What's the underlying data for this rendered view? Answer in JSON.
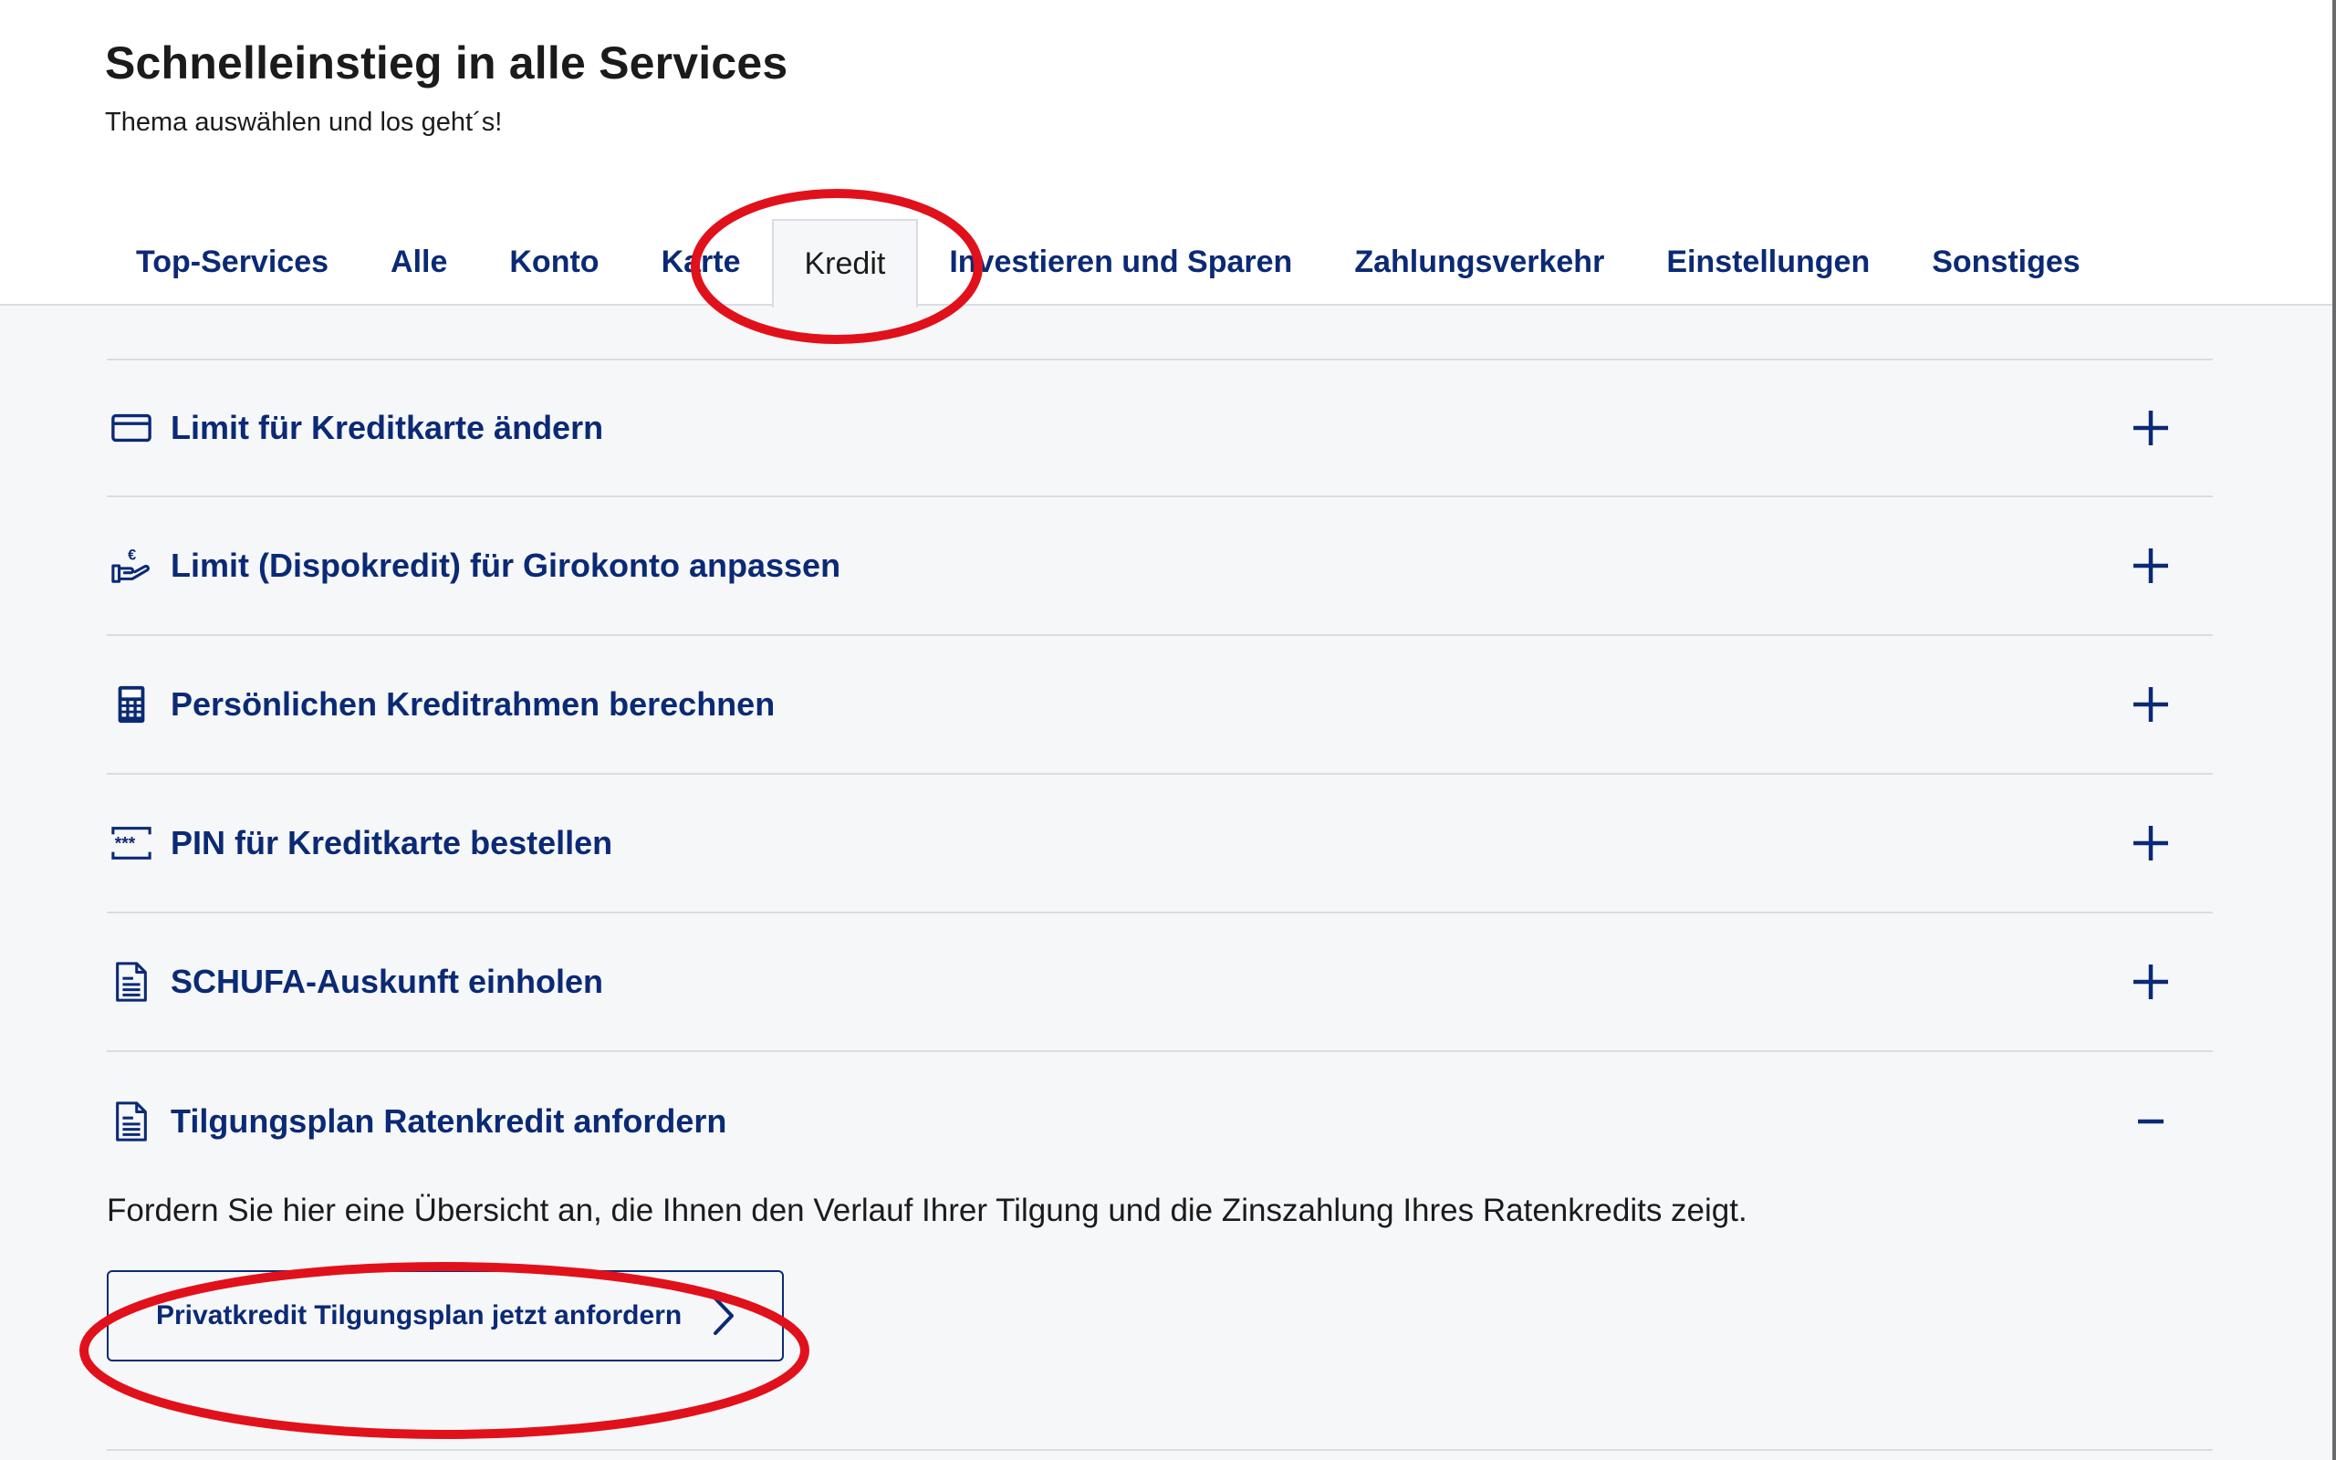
{
  "header": {
    "title": "Schnelleinstieg in alle Services",
    "subtitle": "Thema auswählen und los geht´s!"
  },
  "tabs": [
    {
      "label": "Top-Services",
      "active": false
    },
    {
      "label": "Alle",
      "active": false
    },
    {
      "label": "Konto",
      "active": false
    },
    {
      "label": "Karte",
      "active": false
    },
    {
      "label": "Kredit",
      "active": true
    },
    {
      "label": "Investieren und Sparen",
      "active": false
    },
    {
      "label": "Zahlungsverkehr",
      "active": false
    },
    {
      "label": "Einstellungen",
      "active": false
    },
    {
      "label": "Sonstiges",
      "active": false
    }
  ],
  "services": [
    {
      "label": "Limit für Kreditkarte ändern",
      "icon": "credit-card-icon",
      "expanded": false
    },
    {
      "label": "Limit (Dispokredit) für Girokonto anpassen",
      "icon": "euro-hand-icon",
      "expanded": false
    },
    {
      "label": "Persönlichen Kreditrahmen berechnen",
      "icon": "calculator-icon",
      "expanded": false
    },
    {
      "label": "PIN für Kreditkarte bestellen",
      "icon": "pin-icon",
      "expanded": false
    },
    {
      "label": "SCHUFA-Auskunft einholen",
      "icon": "document-icon",
      "expanded": false
    },
    {
      "label": "Tilgungsplan Ratenkredit anfordern",
      "icon": "document-icon",
      "expanded": true
    }
  ],
  "expanded_item": {
    "description": "Fordern Sie hier eine Übersicht an, die Ihnen den Verlauf Ihrer Tilgung und die Zinszahlung Ihres Ratenkredits zeigt.",
    "button_label": "Privatkredit Tilgungsplan jetzt anfordern"
  },
  "colors": {
    "accent": "#0b2a75",
    "annotation": "#e0111b",
    "background": "#f6f7f9",
    "divider": "#d9dde3"
  }
}
